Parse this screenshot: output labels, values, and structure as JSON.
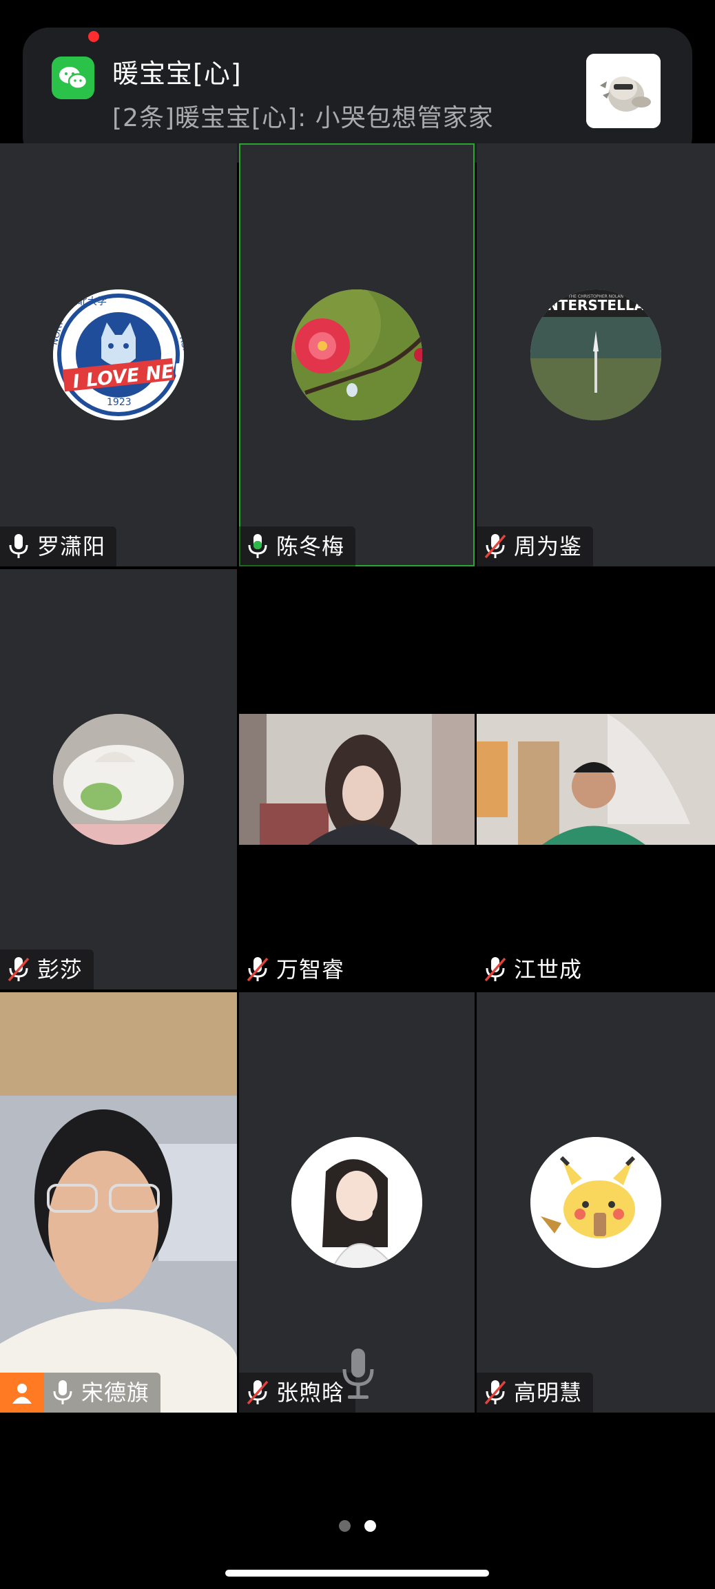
{
  "notification": {
    "title": "暖宝宝[心]",
    "message": "[2条]暖宝宝[心]: 小哭包想管家家"
  },
  "participants": [
    {
      "name": "罗潇阳",
      "mic": "on"
    },
    {
      "name": "陈冬梅",
      "mic": "speaking"
    },
    {
      "name": "周为鉴",
      "mic": "muted"
    },
    {
      "name": "彭莎",
      "mic": "muted"
    },
    {
      "name": "万智睿",
      "mic": "muted"
    },
    {
      "name": "江世成",
      "mic": "muted"
    },
    {
      "name": "宋德旗",
      "mic": "on",
      "host": true
    },
    {
      "name": "张煦晗",
      "mic": "muted"
    },
    {
      "name": "高明慧",
      "mic": "muted"
    }
  ],
  "avatar_texts": {
    "neu_top": "东北大学",
    "neu_left": "NORTHE",
    "neu_right": "RSITY",
    "neu_banner": "I LOVE NEU",
    "neu_year": "1923",
    "interstellar_small": "THE CHRISTOPHER NOLAN",
    "interstellar_title": "NTERSTELLA"
  },
  "pager": {
    "current_page": 2,
    "total_pages": 2
  },
  "colors": {
    "tile_bg": "#2b2c2f",
    "speaking_border": "#2aa52f",
    "mic_speaking": "#2fb84a",
    "host_badge": "#ff7a22",
    "muted_slash": "#e2443c",
    "wechat_green": "#2bc24a"
  }
}
